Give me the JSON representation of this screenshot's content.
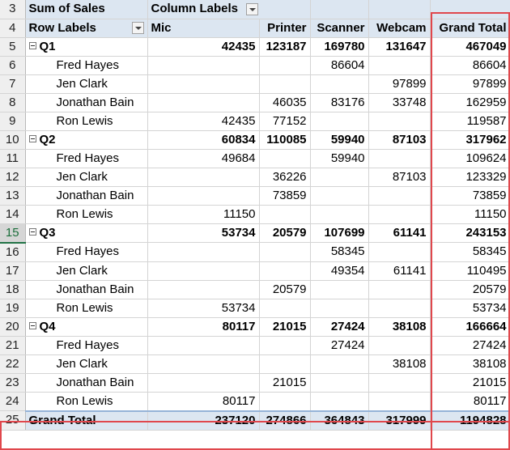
{
  "header": {
    "row3": {
      "num": "3",
      "a": "Sum of Sales",
      "b": "Column Labels"
    },
    "row4": {
      "num": "4",
      "a": "Row Labels",
      "cols": [
        "Mic",
        "Printer",
        "Scanner",
        "Webcam",
        "Grand Total"
      ]
    }
  },
  "rows": [
    {
      "num": "5",
      "type": "q",
      "label": "Q1",
      "vals": [
        "42435",
        "123187",
        "169780",
        "131647",
        "467049"
      ]
    },
    {
      "num": "6",
      "type": "p",
      "label": "Fred Hayes",
      "vals": [
        "",
        "",
        "86604",
        "",
        "86604"
      ]
    },
    {
      "num": "7",
      "type": "p",
      "label": "Jen Clark",
      "vals": [
        "",
        "",
        "",
        "97899",
        "97899"
      ]
    },
    {
      "num": "8",
      "type": "p",
      "label": "Jonathan Bain",
      "vals": [
        "",
        "46035",
        "83176",
        "33748",
        "162959"
      ]
    },
    {
      "num": "9",
      "type": "p",
      "label": "Ron Lewis",
      "vals": [
        "42435",
        "77152",
        "",
        "",
        "119587"
      ]
    },
    {
      "num": "10",
      "type": "q",
      "label": "Q2",
      "vals": [
        "60834",
        "110085",
        "59940",
        "87103",
        "317962"
      ]
    },
    {
      "num": "11",
      "type": "p",
      "label": "Fred Hayes",
      "vals": [
        "49684",
        "",
        "59940",
        "",
        "109624"
      ]
    },
    {
      "num": "12",
      "type": "p",
      "label": "Jen Clark",
      "vals": [
        "",
        "36226",
        "",
        "87103",
        "123329"
      ]
    },
    {
      "num": "13",
      "type": "p",
      "label": "Jonathan Bain",
      "vals": [
        "",
        "73859",
        "",
        "",
        "73859"
      ]
    },
    {
      "num": "14",
      "type": "p",
      "label": "Ron Lewis",
      "vals": [
        "11150",
        "",
        "",
        "",
        "11150"
      ]
    },
    {
      "num": "15",
      "type": "q",
      "label": "Q3",
      "vals": [
        "53734",
        "20579",
        "107699",
        "61141",
        "243153"
      ],
      "selected": true
    },
    {
      "num": "16",
      "type": "p",
      "label": "Fred Hayes",
      "vals": [
        "",
        "",
        "58345",
        "",
        "58345"
      ]
    },
    {
      "num": "17",
      "type": "p",
      "label": "Jen Clark",
      "vals": [
        "",
        "",
        "49354",
        "61141",
        "110495"
      ]
    },
    {
      "num": "18",
      "type": "p",
      "label": "Jonathan Bain",
      "vals": [
        "",
        "20579",
        "",
        "",
        "20579"
      ]
    },
    {
      "num": "19",
      "type": "p",
      "label": "Ron Lewis",
      "vals": [
        "53734",
        "",
        "",
        "",
        "53734"
      ]
    },
    {
      "num": "20",
      "type": "q",
      "label": "Q4",
      "vals": [
        "80117",
        "21015",
        "27424",
        "38108",
        "166664"
      ]
    },
    {
      "num": "21",
      "type": "p",
      "label": "Fred Hayes",
      "vals": [
        "",
        "",
        "27424",
        "",
        "27424"
      ]
    },
    {
      "num": "22",
      "type": "p",
      "label": "Jen Clark",
      "vals": [
        "",
        "",
        "",
        "38108",
        "38108"
      ]
    },
    {
      "num": "23",
      "type": "p",
      "label": "Jonathan Bain",
      "vals": [
        "",
        "21015",
        "",
        "",
        "21015"
      ]
    },
    {
      "num": "24",
      "type": "p",
      "label": "Ron Lewis",
      "vals": [
        "80117",
        "",
        "",
        "",
        "80117"
      ]
    },
    {
      "num": "25",
      "type": "gt",
      "label": "Grand Total",
      "vals": [
        "237120",
        "274866",
        "364843",
        "317999",
        "1194828"
      ]
    }
  ],
  "colors": {
    "highlight": "#e0474c",
    "header_fill": "#dce6f1",
    "selected_row_header": "#217346"
  }
}
